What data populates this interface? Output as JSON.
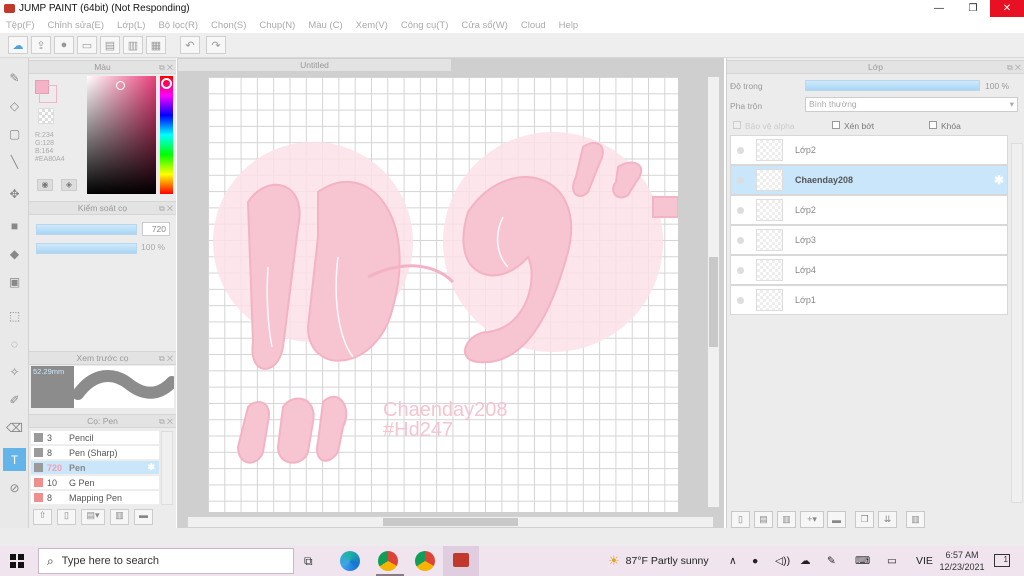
{
  "window": {
    "title": "JUMP PAINT (64bit) (Not Responding)",
    "minimize": "—",
    "maximize": "❐",
    "close": "✕"
  },
  "menu": [
    "Tệp(F)",
    "Chỉnh sửa(E)",
    "Lớp(L)",
    "Bộ lọc(R)",
    "Chọn(S)",
    "Chụp(N)",
    "Màu (C)",
    "Xem(V)",
    "Công cụ(T)",
    "Cửa sổ(W)",
    "Cloud",
    "Help"
  ],
  "color_panel": {
    "title": "Màu",
    "r": "R:234",
    "g": "G:128",
    "b": "B:164",
    "hex": "#EA80A4",
    "current_color": "#f4b4c8"
  },
  "brush_control": {
    "title": "Kiểm soát cọ",
    "size_value": "720",
    "opacity_value": "100 %"
  },
  "preview_panel": {
    "title": "Xem trước cọ",
    "size_label": "52.29mm"
  },
  "pen_panel": {
    "title": "Cọ: Pen",
    "items": [
      {
        "size": "3",
        "name": "Pencil",
        "color": "#9a9a9a"
      },
      {
        "size": "8",
        "name": "Pen (Sharp)",
        "color": "#9a9a9a"
      },
      {
        "size": "720",
        "name": "Pen",
        "color": "#9a9a9a"
      },
      {
        "size": "10",
        "name": "G Pen",
        "color": "#9a9a9a"
      },
      {
        "size": "8",
        "name": "Mapping Pen",
        "color": "#f08e8e"
      }
    ]
  },
  "document": {
    "tab_title": "Untitled",
    "signature_line1": "Chaenday208",
    "signature_line2": "#Hd247"
  },
  "layer_panel": {
    "title": "Lớp",
    "opacity_label": "Độ trong",
    "opacity_value": "100 %",
    "blend_label": "Pha trộn",
    "blend_value": "Bình thường",
    "protect_alpha": "Bảo vệ alpha",
    "clipping": "Xén bớt",
    "lock": "Khóa",
    "layers": [
      {
        "name": "Lớp2"
      },
      {
        "name": "Chaenday208"
      },
      {
        "name": "Lớp2"
      },
      {
        "name": "Lớp3"
      },
      {
        "name": "Lớp4"
      },
      {
        "name": "Lớp1"
      }
    ]
  },
  "taskbar": {
    "search_placeholder": "Type here to search",
    "weather": "87°F  Partly sunny",
    "language": "VIE",
    "time": "6:57 AM",
    "date": "12/23/2021",
    "notifications": "1"
  }
}
